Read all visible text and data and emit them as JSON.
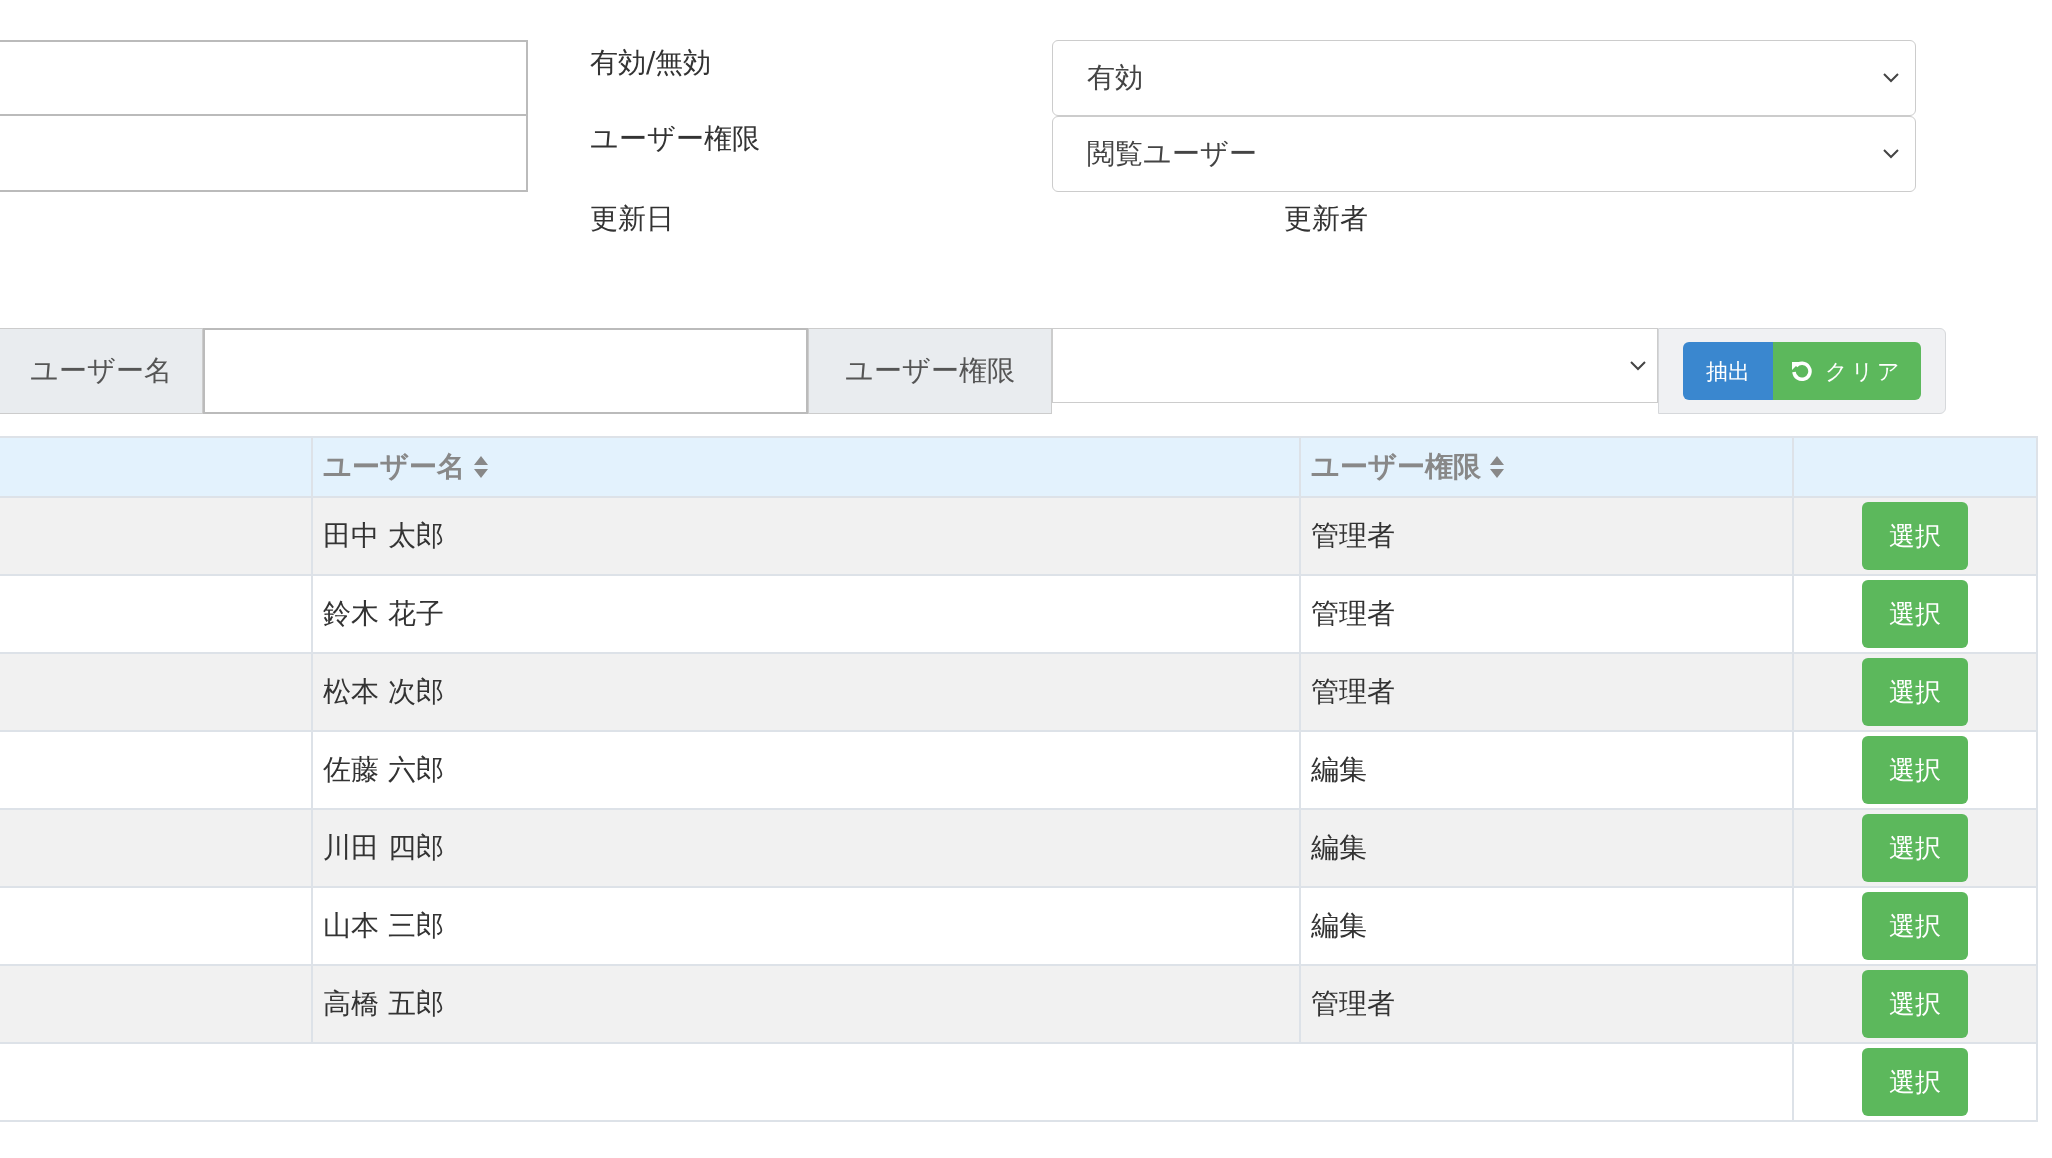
{
  "form": {
    "fields": [
      {
        "label": "有効/無効",
        "value": "有効"
      },
      {
        "label": "ユーザー権限",
        "value": "閲覧ユーザー"
      }
    ],
    "updated_date_label": "更新日",
    "updated_by_label": "更新者"
  },
  "search": {
    "name_label": "ユーザー名",
    "role_label": "ユーザー権限",
    "extract_button": "抽出",
    "clear_button": "クリア"
  },
  "table": {
    "columns": [
      "ユーザー名",
      "ユーザー権限"
    ],
    "rows": [
      {
        "name": "田中 太郎",
        "role": "管理者",
        "button": "選択"
      },
      {
        "name": "鈴木 花子",
        "role": "管理者",
        "button": "選択"
      },
      {
        "name": "松本 次郎",
        "role": "管理者",
        "button": "選択"
      },
      {
        "name": "佐藤 六郎",
        "role": "編集",
        "button": "選択"
      },
      {
        "name": "川田 四郎",
        "role": "編集",
        "button": "選択"
      },
      {
        "name": "山本 三郎",
        "role": "編集",
        "button": "選択"
      },
      {
        "name": "高橋 五郎",
        "role": "管理者",
        "button": "選択"
      },
      {
        "button": "選択"
      }
    ]
  }
}
